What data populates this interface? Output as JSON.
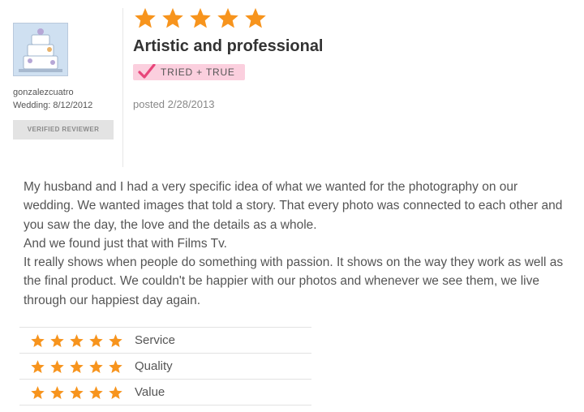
{
  "reviewer": {
    "username": "gonzalezcuatro",
    "wedding": "Wedding: 8/12/2012",
    "verified_label": "VERIFIED REVIEWER"
  },
  "review": {
    "overall_rating": 5,
    "title": "Artistic and professional",
    "badge_label": "TRIED + TRUE",
    "posted": "posted 2/28/2013",
    "body": [
      "My husband and I had a very specific idea of what we wanted for the photography on our wedding. We wanted images that told a story. That every photo was connected to each other and you saw the day, the love and the details as a whole.",
      "And we found just that with Films Tv.",
      "It really shows when people do something with passion. It shows on the way they work as well as the final product. We couldn't be happier with our photos and whenever we see them, we live through our happiest day again."
    ]
  },
  "ratings": [
    {
      "label": "Service",
      "stars": 5
    },
    {
      "label": "Quality",
      "stars": 5
    },
    {
      "label": "Value",
      "stars": 5
    }
  ],
  "icons": {
    "star": "star-icon",
    "check": "checkmark-icon",
    "avatar": "wedding-cake-image"
  },
  "colors": {
    "star": "#f7941d",
    "badge_bg": "#fbcfde",
    "check": "#e8457a",
    "verified_bg": "#e3e3e3"
  }
}
